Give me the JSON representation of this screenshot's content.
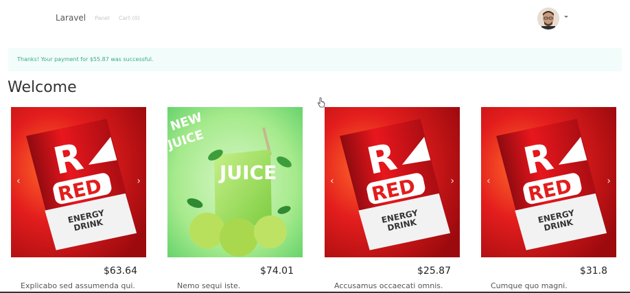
{
  "navbar": {
    "brand": "Laravel",
    "links": [
      {
        "label": "Panel"
      },
      {
        "label": "Cart (0)"
      }
    ]
  },
  "alert": {
    "message": "Thanks! Your payment for $55.87 was successful."
  },
  "main": {
    "title": "Welcome"
  },
  "products": [
    {
      "image": "red-energy-drink-can",
      "price": "$63.64",
      "description": "Explicabo sed assumenda qui."
    },
    {
      "image": "new-juice-box",
      "price": "$74.01",
      "description": "Nemo sequi iste."
    },
    {
      "image": "red-energy-drink-can",
      "price": "$25.87",
      "description": "Accusamus occaecati omnis."
    },
    {
      "image": "red-energy-drink-can",
      "price": "$31.8",
      "description": "Cumque quo magni."
    }
  ],
  "colors": {
    "alert_bg": "#f2fcfa",
    "alert_text": "#3ba88e",
    "can_red": "#d9141b",
    "juice_green": "#9be07c"
  }
}
